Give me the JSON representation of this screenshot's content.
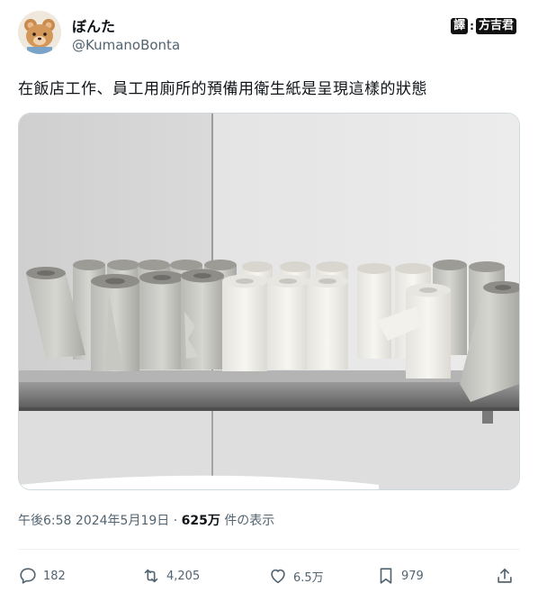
{
  "author": {
    "display_name": "ぼんた",
    "handle": "@KumanoBonta",
    "avatar_icon": "teddy-bear-avatar-icon"
  },
  "translator_badge": {
    "label_left": "譯",
    "separator": ":",
    "label_right": "方吉君"
  },
  "tweet": {
    "text": "在飯店工作、員工用廁所的預備用衛生紙是呈現這樣的狀態"
  },
  "meta": {
    "time": "午後6:58",
    "date": "2024年5月19日",
    "separator": "·",
    "views_count": "625万",
    "views_label": "件の表示"
  },
  "actions": {
    "reply_count": "182",
    "retweet_count": "4,205",
    "like_count": "6.5万",
    "bookmark_count": "979"
  },
  "colors": {
    "text_primary": "#0f1419",
    "text_secondary": "#536471",
    "divider": "#eff3f4"
  }
}
